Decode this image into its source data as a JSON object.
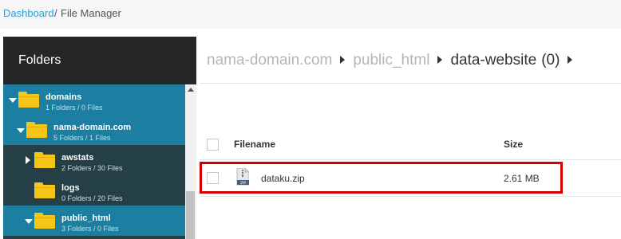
{
  "breadcrumb": {
    "dashboard": "Dashboard",
    "separator": "/",
    "current": "File Manager"
  },
  "sidebar": {
    "title": "Folders",
    "tree": [
      {
        "name": "domains",
        "meta": "1 Folders / 0 Files",
        "expanded": true
      },
      {
        "name": "nama-domain.com",
        "meta": "5 Folders / 1 Files",
        "expanded": true
      },
      {
        "name": "awstats",
        "meta": "2 Folders / 30 Files",
        "expanded": false
      },
      {
        "name": "logs",
        "meta": "0 Folders / 20 Files",
        "expanded": false
      },
      {
        "name": "public_html",
        "meta": "3 Folders / 0 Files",
        "expanded": true
      }
    ]
  },
  "path": {
    "segments": [
      "nama-domain.com",
      "public_html"
    ],
    "current": "data-website",
    "count": "(0)"
  },
  "table": {
    "headers": {
      "filename": "Filename",
      "size": "Size"
    },
    "rows": [
      {
        "filename": "dataku.zip",
        "size": "2.61 MB",
        "icon": "zip-file-icon"
      }
    ]
  },
  "colors": {
    "link": "#2a9fd6",
    "selected_row": "#1c7fa1",
    "tree_bg": "#253f46",
    "folder": "#f5c518",
    "highlight": "#d40000"
  }
}
